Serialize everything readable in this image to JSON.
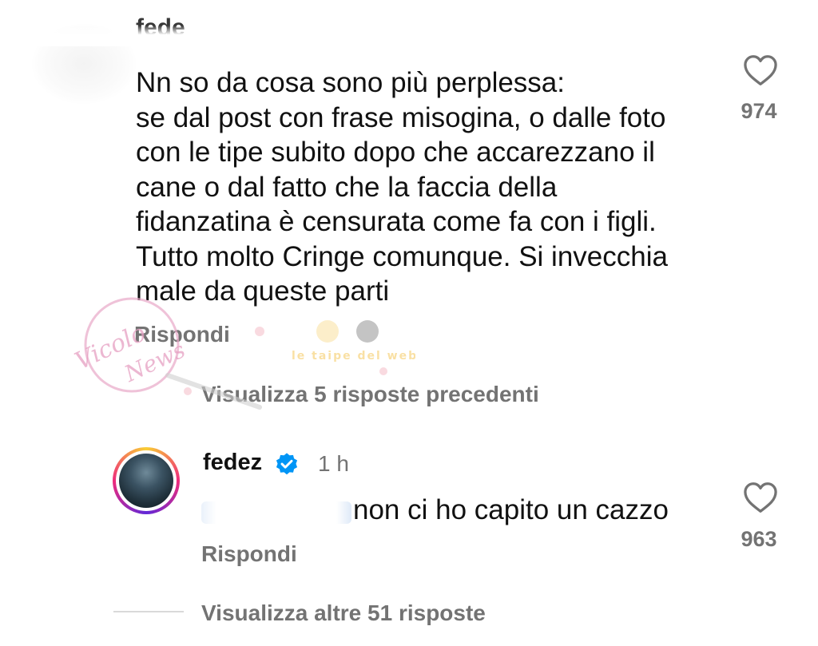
{
  "comments": [
    {
      "username": "fede",
      "text": "Nn so da cosa sono più perplessa:\nse dal post con frase misogina, o dalle foto\ncon le tipe subito dopo che accarezzano il\ncane o dal fatto che la faccia della\nfidanzatina è censurata come fa con i figli.\nTutto molto Cringe comunque. Si invecchia\nmale da queste parti",
      "likes": "974",
      "reply_label": "Rispondi",
      "view_replies_label": "Visualizza 5 risposte precedenti"
    },
    {
      "username": "fedez",
      "verified": true,
      "time": "1 h",
      "text": "non ci ho capito un cazzo",
      "likes": "963",
      "reply_label": "Rispondi",
      "view_more_label": "Visualizza altre 51 risposte"
    }
  ],
  "colors": {
    "text": "#111111",
    "muted": "#737373",
    "verified": "#0095f6"
  },
  "icons": [
    "heart-icon",
    "verified-badge-icon"
  ],
  "watermark": {
    "text": "Vicolo della News",
    "tagline": "le taipe del web"
  }
}
